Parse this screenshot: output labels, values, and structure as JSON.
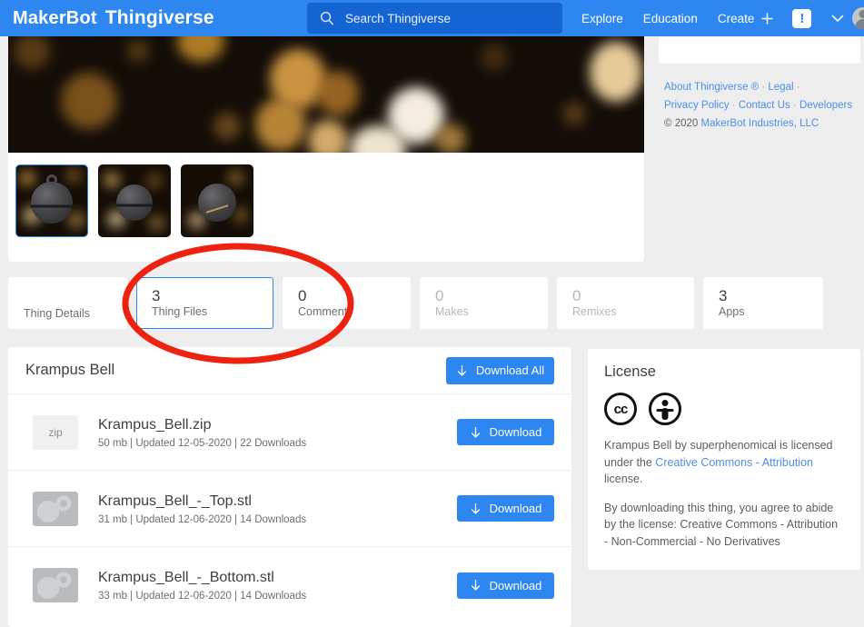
{
  "header": {
    "brand_primary": "MakerBot",
    "brand_secondary": "Thingiverse",
    "search_placeholder": "Search Thingiverse",
    "search_icon": "search-icon",
    "nav": [
      {
        "label": "Explore"
      },
      {
        "label": "Education"
      },
      {
        "label": "Create"
      }
    ],
    "create_plus_icon": "plus-icon",
    "alert_badge": "!",
    "chevron_icon": "chevron-down-icon",
    "avatar_icon": "avatar",
    "accent_color": "#2e86f0",
    "search_bg_color": "#1464d4"
  },
  "gallery": {
    "hero_alt": "bokeh-lights-photo",
    "thumbnails": [
      {
        "name": "thumbnail-1",
        "selected": true
      },
      {
        "name": "thumbnail-2",
        "selected": false
      },
      {
        "name": "thumbnail-3",
        "selected": false
      }
    ]
  },
  "tabs": [
    {
      "count": "",
      "label": "Thing Details",
      "selected": false,
      "muted": false
    },
    {
      "count": "3",
      "label": "Thing Files",
      "selected": true,
      "muted": false
    },
    {
      "count": "0",
      "label": "Comments",
      "selected": false,
      "muted": false
    },
    {
      "count": "0",
      "label": "Makes",
      "selected": false,
      "muted": true
    },
    {
      "count": "0",
      "label": "Remixes",
      "selected": false,
      "muted": true
    },
    {
      "count": "3",
      "label": "Apps",
      "selected": false,
      "muted": false
    }
  ],
  "files": {
    "title": "Krampus Bell",
    "download_all_label": "Download All",
    "download_label": "Download",
    "download_icon": "download-arrow-icon",
    "rows": [
      {
        "icon_type": "zip",
        "icon_text": "zip",
        "name": "Krampus_Bell.zip",
        "size": "50 mb",
        "updated": "Updated 12-05-2020",
        "downloads": "22 Downloads",
        "meta": "50 mb | Updated 12-05-2020 | 22 Downloads"
      },
      {
        "icon_type": "stl",
        "icon_text": "",
        "name": "Krampus_Bell_-_Top.stl",
        "size": "31 mb",
        "updated": "Updated 12-06-2020",
        "downloads": "14 Downloads",
        "meta": "31 mb | Updated 12-06-2020 | 14 Downloads"
      },
      {
        "icon_type": "stl",
        "icon_text": "",
        "name": "Krampus_Bell_-_Bottom.stl",
        "size": "33 mb",
        "updated": "Updated 12-06-2020",
        "downloads": "14 Downloads",
        "meta": "33 mb | Updated 12-06-2020 | 14 Downloads"
      }
    ]
  },
  "license": {
    "title": "License",
    "cc_icon": "creative-commons-icon",
    "by_icon": "attribution-person-icon",
    "cc_label": "cc",
    "attribution_prefix": "Krampus Bell by  superphenomical  is licensed under the ",
    "attribution_link": "Creative Commons - Attribution",
    "attribution_suffix": " license.",
    "agreement": "By downloading this thing, you agree to abide by the license: Creative Commons - Attribution - Non-Commercial - No Derivatives"
  },
  "sidebar_footer": {
    "links": [
      {
        "label": "About Thingiverse ®"
      },
      {
        "label": "Legal"
      },
      {
        "label": "Privacy Policy"
      },
      {
        "label": "Contact Us"
      },
      {
        "label": "Developers"
      }
    ],
    "copyright_mark": "©",
    "copyright_year": "2020",
    "copyright_owner": "MakerBot Industries, LLC"
  },
  "annotation": {
    "shape": "ellipse",
    "color": "#ee2211",
    "target": "Thing Files tab"
  }
}
